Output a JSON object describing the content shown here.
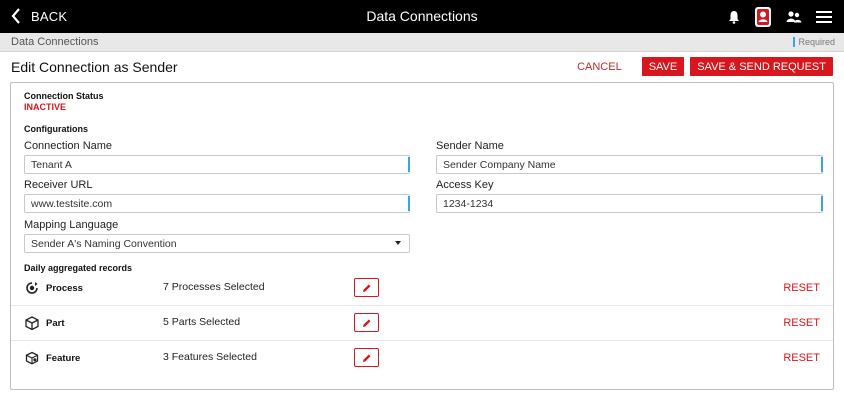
{
  "header": {
    "back_label": "BACK",
    "title": "Data Connections",
    "icons": [
      "bell-icon",
      "profile-badge-icon",
      "people-icon",
      "menu-icon"
    ]
  },
  "breadcrumb": {
    "current": "Data Connections",
    "required_label": "Required"
  },
  "page": {
    "title": "Edit Connection as Sender",
    "cancel_label": "CANCEL",
    "save_label": "SAVE",
    "save_send_label": "SAVE & SEND REQUEST"
  },
  "status": {
    "label": "Connection Status",
    "value": "INACTIVE"
  },
  "configurations": {
    "heading": "Configurations",
    "connection_name": {
      "label": "Connection Name",
      "value": "Tenant A"
    },
    "sender_name": {
      "label": "Sender Name",
      "value": "Sender Company Name"
    },
    "receiver_url": {
      "label": "Receiver URL",
      "value": "www.testsite.com"
    },
    "access_key": {
      "label": "Access Key",
      "value": "1234-1234"
    },
    "mapping_language": {
      "label": "Mapping Language",
      "value": "Sender A's Naming Convention"
    }
  },
  "daily": {
    "heading": "Daily aggregated records",
    "reset_label": "RESET",
    "rows": [
      {
        "icon": "gear-cycle-icon",
        "name": "Process",
        "value": "7 Processes Selected"
      },
      {
        "icon": "box-icon",
        "name": "Part",
        "value": "5 Parts Selected"
      },
      {
        "icon": "cube-feature-icon",
        "name": "Feature",
        "value": "3 Features Selected"
      }
    ]
  },
  "colors": {
    "accent_red": "#d8161d",
    "required_blue": "#3aa3e0",
    "topbar": "#000000"
  }
}
